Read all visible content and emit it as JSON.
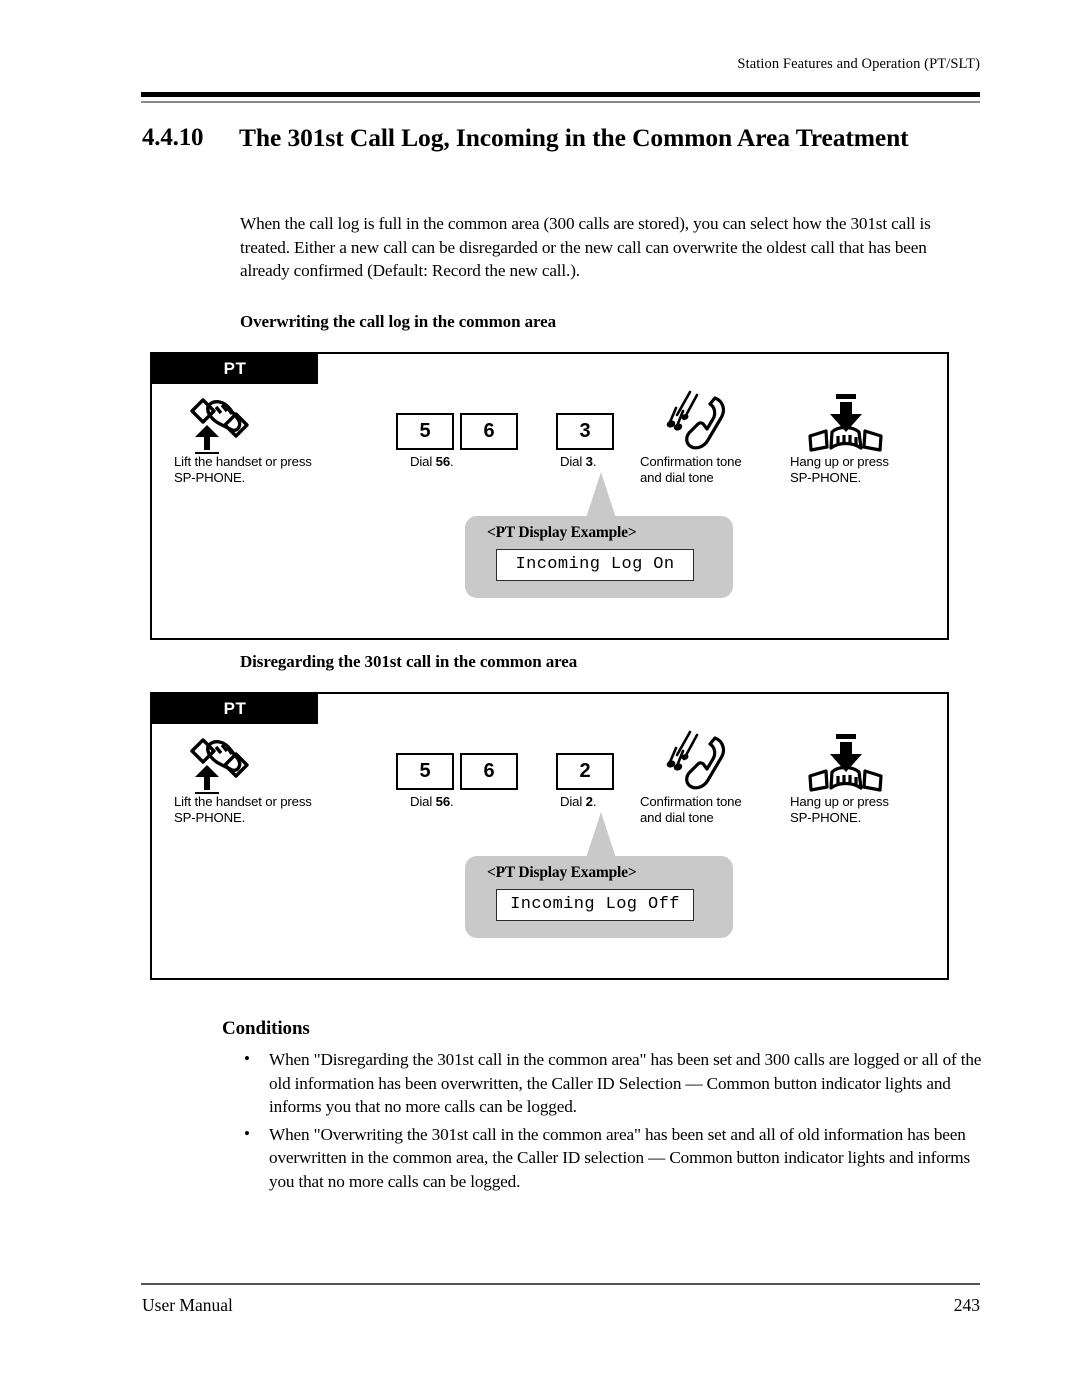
{
  "header": {
    "running_head": "Station Features and Operation (PT/SLT)"
  },
  "section": {
    "number": "4.4.10",
    "title": "The 301st Call Log, Incoming in the Common Area Treatment"
  },
  "intro": "When the call log is full in the common area (300 calls are stored), you can select how the 301st call is treated. Either a new call can be disregarded or the new call can overwrite the oldest call that has been already confirmed (Default: Record the new call.).",
  "procedures": [
    {
      "heading": "Overwriting the call log in the common area",
      "badge": "PT",
      "steps": [
        {
          "icon": "lift-handset-icon",
          "caption": "Lift the handset or press\nSP-PHONE."
        },
        {
          "icon": "keypad-keys",
          "keys": [
            "5",
            "6"
          ],
          "caption_plain": "Dial ",
          "caption_bold": "56",
          "caption_tail": "."
        },
        {
          "icon": "keypad-keys",
          "keys": [
            "3"
          ],
          "caption_plain": "Dial ",
          "caption_bold": "3",
          "caption_tail": "."
        },
        {
          "icon": "ringing-handset-icon",
          "caption": "Confirmation tone\nand dial tone"
        },
        {
          "icon": "hang-up-icon",
          "caption": "Hang up or press\nSP-PHONE."
        }
      ],
      "callout": {
        "title": "<PT Display Example>",
        "display_text": "Incoming Log On"
      }
    },
    {
      "heading": "Disregarding the 301st call in the common area",
      "badge": "PT",
      "steps": [
        {
          "icon": "lift-handset-icon",
          "caption": "Lift the handset or press\nSP-PHONE."
        },
        {
          "icon": "keypad-keys",
          "keys": [
            "5",
            "6"
          ],
          "caption_plain": "Dial ",
          "caption_bold": "56",
          "caption_tail": "."
        },
        {
          "icon": "keypad-keys",
          "keys": [
            "2"
          ],
          "caption_plain": "Dial ",
          "caption_bold": "2",
          "caption_tail": "."
        },
        {
          "icon": "ringing-handset-icon",
          "caption": "Confirmation tone\nand dial tone"
        },
        {
          "icon": "hang-up-icon",
          "caption": "Hang up or press\nSP-PHONE."
        }
      ],
      "callout": {
        "title": "<PT Display Example>",
        "display_text": "Incoming Log Off"
      }
    }
  ],
  "conditions": {
    "heading": "Conditions",
    "bullet_glyph": "•",
    "items": [
      "When \"Disregarding the 301st call in the common area\" has been set and 300 calls are logged or all of the old information has been overwritten, the Caller ID Selection — Common button indicator lights and informs you that no more calls can be logged.",
      "When \"Overwriting the 301st call in the common area\" has been set and all of old information has been overwritten in the common area, the Caller ID selection — Common button indicator lights and informs you that no more calls can be logged."
    ]
  },
  "footer": {
    "left": "User Manual",
    "page_number": "243"
  },
  "colors": {
    "callout_gray": "#c9c9c9",
    "badge_bg": "#000000",
    "rule": "#000000"
  }
}
